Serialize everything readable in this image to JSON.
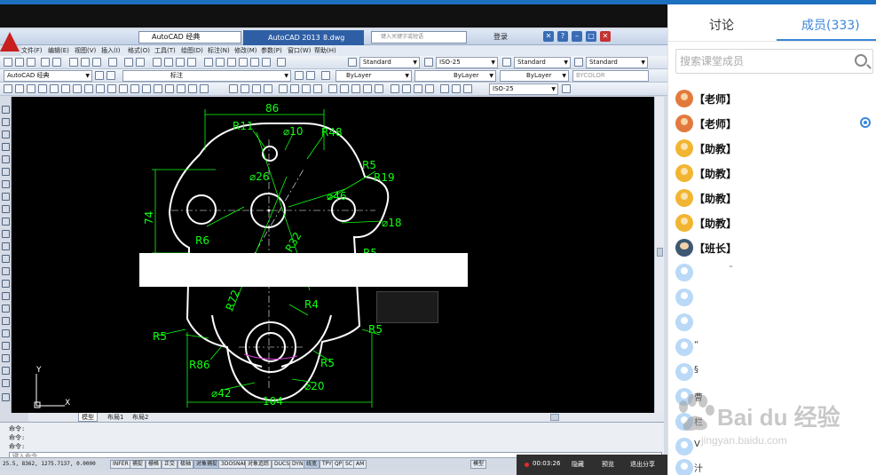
{
  "cad": {
    "workspace": "AutoCAD 经典",
    "app_title": "AutoCAD 2013",
    "file_name": "8.dwg",
    "search_placeholder": "键入关键字或短语",
    "login": "登录",
    "menu": [
      "文件(F)",
      "编辑(E)",
      "视图(V)",
      "插入(I)",
      "格式(O)",
      "工具(T)",
      "绘图(D)",
      "标注(N)",
      "修改(M)",
      "参数(P)",
      "窗口(W)",
      "帮助(H)"
    ],
    "toolbar": {
      "text_style_1": "Standard",
      "dim_style": "ISO-25",
      "table_style": "Standard",
      "mleader_style": "Standard",
      "workspace_dd": "AutoCAD 经典",
      "layer": "标注",
      "color": "ByLayer",
      "linetype": "ByLayer",
      "lineweight": "ByLayer",
      "plotstyle": "BYCOLOR",
      "dim_style_2": "ISO-25"
    },
    "dims": {
      "d86": "86",
      "r11": "R11",
      "d10": "⌀10",
      "r48": "R48",
      "r5a": "R5",
      "r19": "R19",
      "d26": "⌀26",
      "d46": "⌀46",
      "d74": "74",
      "d18": "⌀18",
      "r6": "R6",
      "r32": "R32",
      "r5b": "R5",
      "r4": "R4",
      "r5c": "R5",
      "r5d": "R5",
      "r72": "R72",
      "r86": "R86",
      "r5e": "R5",
      "d42": "⌀42",
      "d20": "⌀20",
      "d104": "104"
    },
    "ucs": {
      "y": "Y",
      "x": "X"
    },
    "layout_tabs": [
      "模型",
      "布局1",
      "布局2"
    ],
    "command_lines": [
      "命令:",
      "命令:",
      "命令:"
    ],
    "command_prompt": "键入命令",
    "coords": "25.5, 8362, 1275.7137, 0.0000",
    "status_items": [
      "INFER",
      "捕捉",
      "栅格",
      "正交",
      "极轴",
      "对象捕捉",
      "3DOSNAP",
      "对象追踪",
      "DUCS",
      "DYN",
      "线宽",
      "TPY",
      "QP",
      "SC",
      "AM"
    ],
    "status_model": "模型"
  },
  "live": {
    "timer": "00:03:26",
    "mute": "隐藏",
    "preview": "预览",
    "exit_share": "退出分享"
  },
  "panel": {
    "tab_discuss": "讨论",
    "tab_members": "成员(333)",
    "search_placeholder": "搜索课堂成员",
    "members": [
      {
        "role": "teacher",
        "name": "【老师】"
      },
      {
        "role": "teacher",
        "name": "【老师】"
      },
      {
        "role": "ta",
        "name": "【助教】"
      },
      {
        "role": "ta",
        "name": "【助教】"
      },
      {
        "role": "ta",
        "name": "【助教】"
      },
      {
        "role": "ta",
        "name": "【助教】"
      },
      {
        "role": "monitor",
        "name": "【班长】"
      },
      {
        "role": "student",
        "name": "¨"
      },
      {
        "role": "student",
        "name": ""
      },
      {
        "role": "student",
        "name": ""
      },
      {
        "role": "student",
        "name": "“"
      },
      {
        "role": "student",
        "name": "§"
      },
      {
        "role": "student",
        "name": "曹"
      },
      {
        "role": "student",
        "name": "栏"
      },
      {
        "role": "student",
        "name": "V"
      },
      {
        "role": "student",
        "name": "汁"
      }
    ]
  },
  "watermark": {
    "text": "Bai du 经验",
    "url": "jingyan.baidu.com"
  }
}
